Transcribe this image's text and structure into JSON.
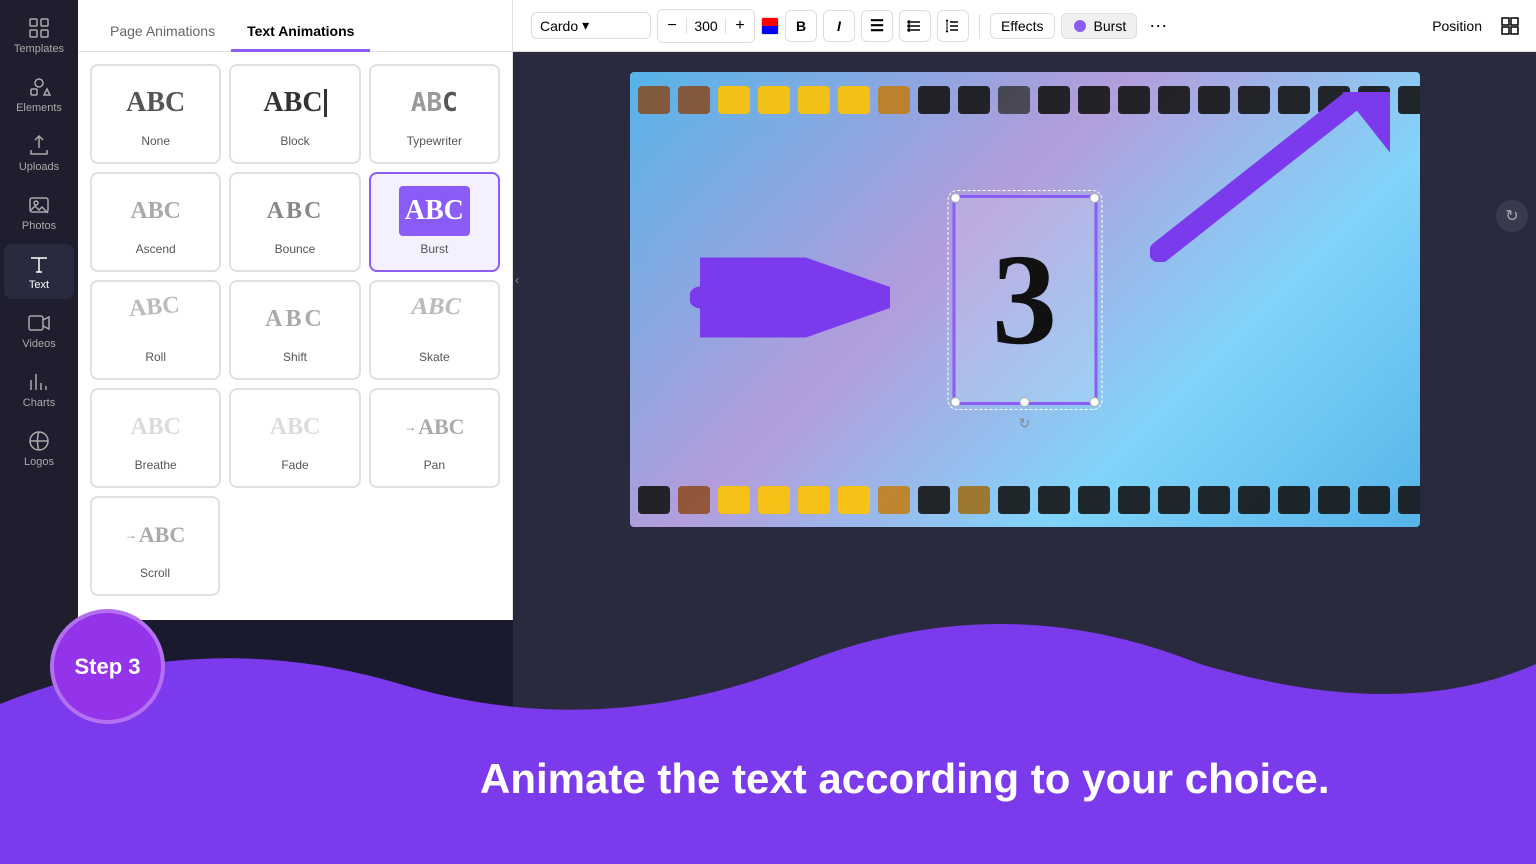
{
  "sidebar": {
    "items": [
      {
        "id": "templates",
        "label": "Templates",
        "icon": "grid"
      },
      {
        "id": "elements",
        "label": "Elements",
        "icon": "shapes"
      },
      {
        "id": "uploads",
        "label": "Uploads",
        "icon": "upload"
      },
      {
        "id": "photos",
        "label": "Photos",
        "icon": "photo"
      },
      {
        "id": "text",
        "label": "Text",
        "icon": "text",
        "active": true
      },
      {
        "id": "videos",
        "label": "Videos",
        "icon": "video"
      },
      {
        "id": "charts",
        "label": "Charts",
        "icon": "chart"
      },
      {
        "id": "logos",
        "label": "Logos",
        "icon": "logo"
      },
      {
        "id": "more",
        "label": "...",
        "icon": "more"
      }
    ]
  },
  "animation_panel": {
    "tabs": [
      {
        "id": "page",
        "label": "Page Animations",
        "active": false
      },
      {
        "id": "text",
        "label": "Text Animations",
        "active": true
      }
    ],
    "animations": [
      {
        "id": "none",
        "label": "None",
        "preview": "ABC",
        "style": "none",
        "selected": false
      },
      {
        "id": "block",
        "label": "Block",
        "preview": "ABC",
        "style": "block",
        "selected": false
      },
      {
        "id": "typewriter",
        "label": "Typewriter",
        "preview": "ABC",
        "style": "typewriter",
        "selected": false
      },
      {
        "id": "ascend",
        "label": "Ascend",
        "preview": "ABC",
        "style": "ascend",
        "selected": false
      },
      {
        "id": "bounce",
        "label": "Bounce",
        "preview": "ABC",
        "style": "bounce",
        "selected": false
      },
      {
        "id": "burst",
        "label": "Burst",
        "preview": "ABC",
        "style": "burst",
        "selected": true
      },
      {
        "id": "roll",
        "label": "Roll",
        "preview": "ABC",
        "style": "roll",
        "selected": false
      },
      {
        "id": "shift",
        "label": "Shift",
        "preview": "ABC",
        "style": "shift",
        "selected": false
      },
      {
        "id": "skate",
        "label": "Skate",
        "preview": "ABC",
        "style": "skate",
        "selected": false
      },
      {
        "id": "breathe",
        "label": "Breathe",
        "preview": "ABC",
        "style": "breathe",
        "selected": false
      },
      {
        "id": "fade",
        "label": "Fade",
        "preview": "ABC",
        "style": "fade",
        "selected": false
      },
      {
        "id": "pan",
        "label": "Pan",
        "preview": "ABC",
        "style": "pan",
        "selected": false
      },
      {
        "id": "scroll",
        "label": "Scroll",
        "preview": "ABC",
        "style": "scroll",
        "selected": false
      }
    ]
  },
  "toolbar": {
    "font_name": "Cardo",
    "font_size": "300",
    "effects_label": "Effects",
    "burst_label": "Burst",
    "position_label": "Position",
    "more_icon": "···"
  },
  "canvas": {
    "number": "3"
  },
  "bottom": {
    "step_label": "Step 3",
    "description": "Animate the text according to your choice."
  }
}
